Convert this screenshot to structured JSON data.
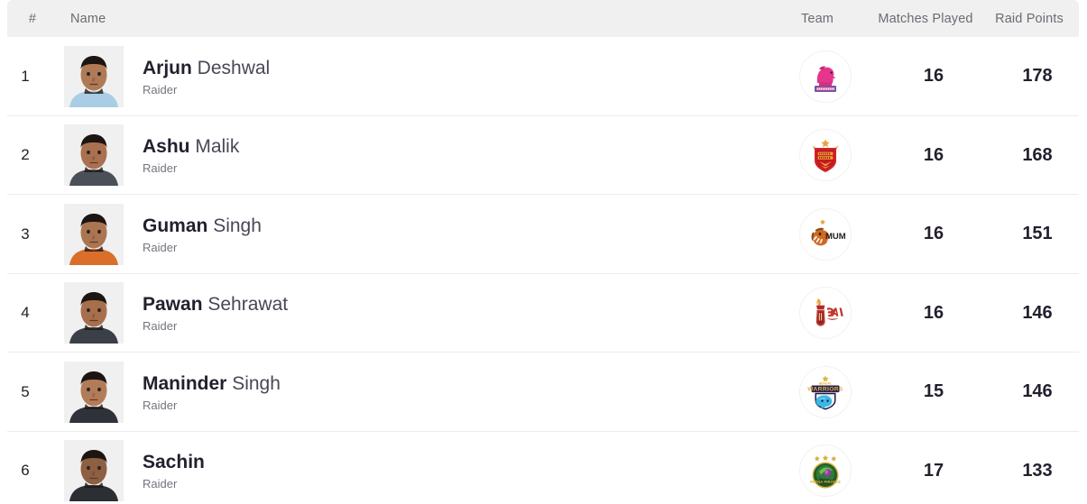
{
  "header": {
    "rank": "#",
    "name": "Name",
    "team": "Team",
    "matches_played": "Matches Played",
    "raid_points": "Raid Points"
  },
  "colors": {
    "header_bg": "#f0f0f0",
    "header_text": "#6b6b73",
    "row_divider": "#ececec",
    "name_primary": "#241f2e",
    "name_secondary": "#4b4655",
    "role_text": "#77737e",
    "stat_text": "#241f2e",
    "photo_bg": "#f0f0f0"
  },
  "rows": [
    {
      "rank": "1",
      "first_name": "Arjun",
      "last_name": "Deshwal",
      "role": "Raider",
      "team_name": "Jaipur Pink Panthers",
      "team_logo": "jaipur-pink-panthers-logo",
      "matches_played": "16",
      "raid_points": "178"
    },
    {
      "rank": "2",
      "first_name": "Ashu",
      "last_name": "Malik",
      "role": "Raider",
      "team_name": "Dabang Delhi",
      "team_logo": "dabang-delhi-logo",
      "matches_played": "16",
      "raid_points": "168"
    },
    {
      "rank": "3",
      "first_name": "Guman",
      "last_name": "Singh",
      "role": "Raider",
      "team_name": "U Mumba",
      "team_logo": "u-mumba-logo",
      "matches_played": "16",
      "raid_points": "151"
    },
    {
      "rank": "4",
      "first_name": "Pawan",
      "last_name": "Sehrawat",
      "role": "Raider",
      "team_name": "Telugu Titans",
      "team_logo": "telugu-titans-logo",
      "matches_played": "16",
      "raid_points": "146"
    },
    {
      "rank": "5",
      "first_name": "Maninder",
      "last_name": "Singh",
      "role": "Raider",
      "team_name": "Bengal Warriors",
      "team_logo": "bengal-warriors-logo",
      "matches_played": "15",
      "raid_points": "146"
    },
    {
      "rank": "6",
      "first_name": "Sachin",
      "last_name": "",
      "role": "Raider",
      "team_name": "Patna Pirates",
      "team_logo": "patna-pirates-logo",
      "matches_played": "17",
      "raid_points": "133"
    }
  ]
}
